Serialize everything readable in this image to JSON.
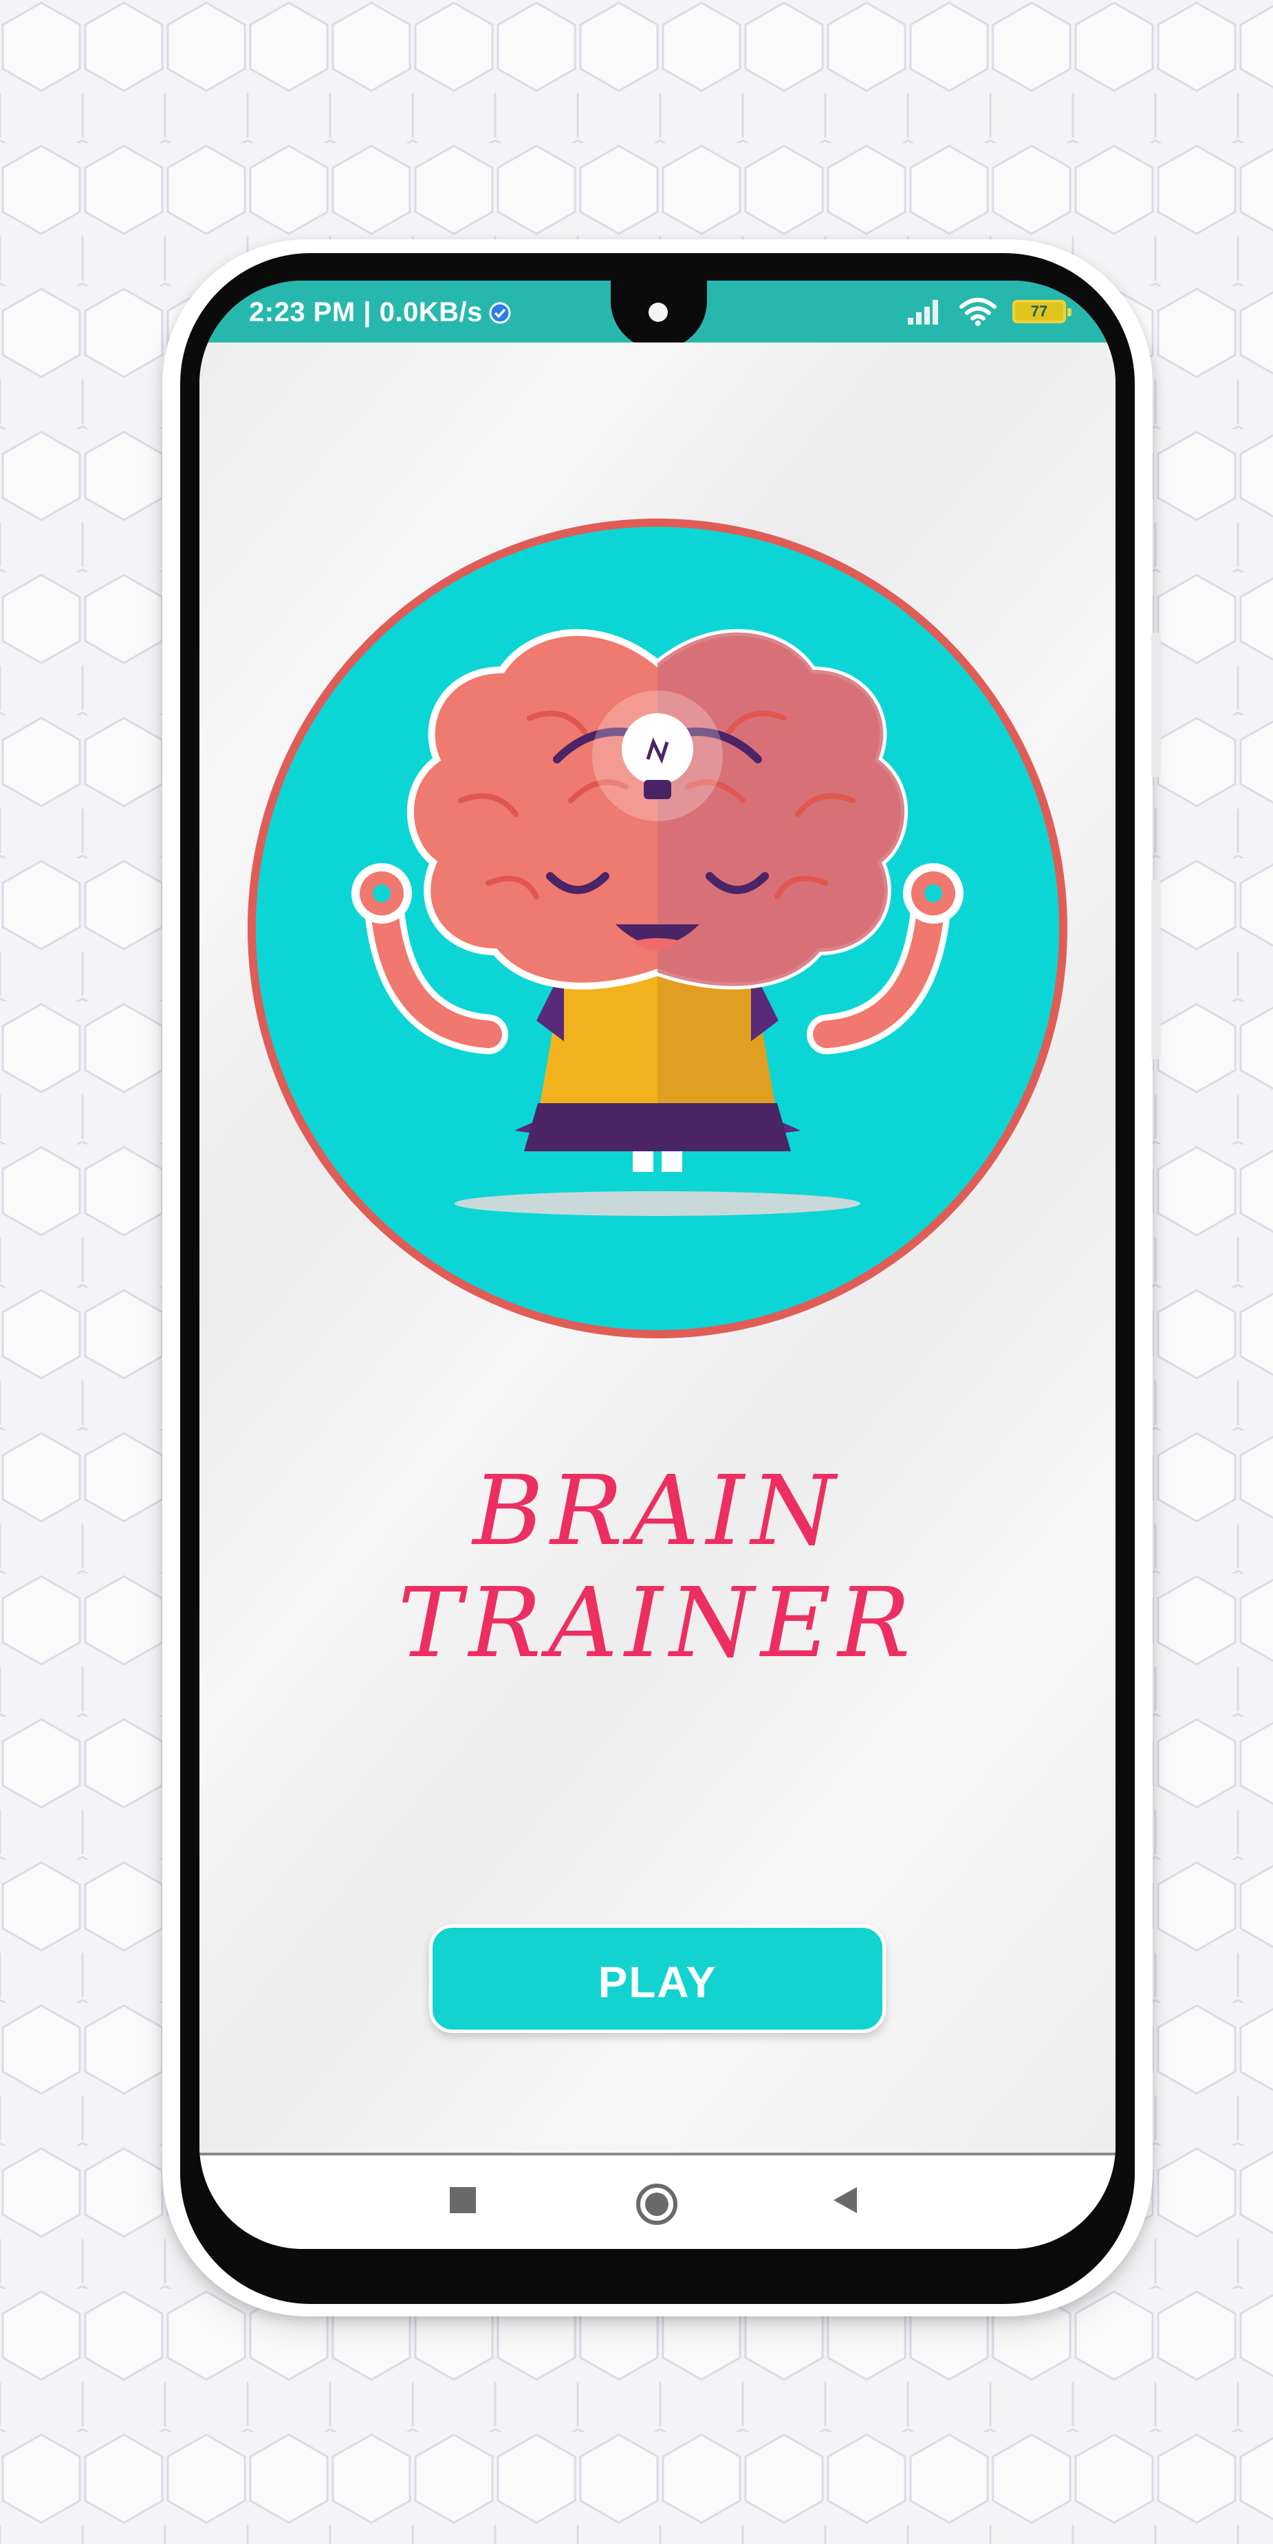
{
  "statusbar": {
    "time_speed": "2:23 PM | 0.0KB/s",
    "battery": "77"
  },
  "app": {
    "title": "BRAIN TRAINER",
    "play_label": "PLAY"
  },
  "colors": {
    "accent": "#12d3cf",
    "title": "#ec2f60",
    "statusbar": "#27b8ad",
    "logo_ring": "#e05d57"
  },
  "icons": [
    "verified-icon",
    "signal-icon",
    "wifi-icon",
    "battery-icon",
    "brain-logo",
    "recents-icon",
    "home-icon",
    "back-icon"
  ]
}
